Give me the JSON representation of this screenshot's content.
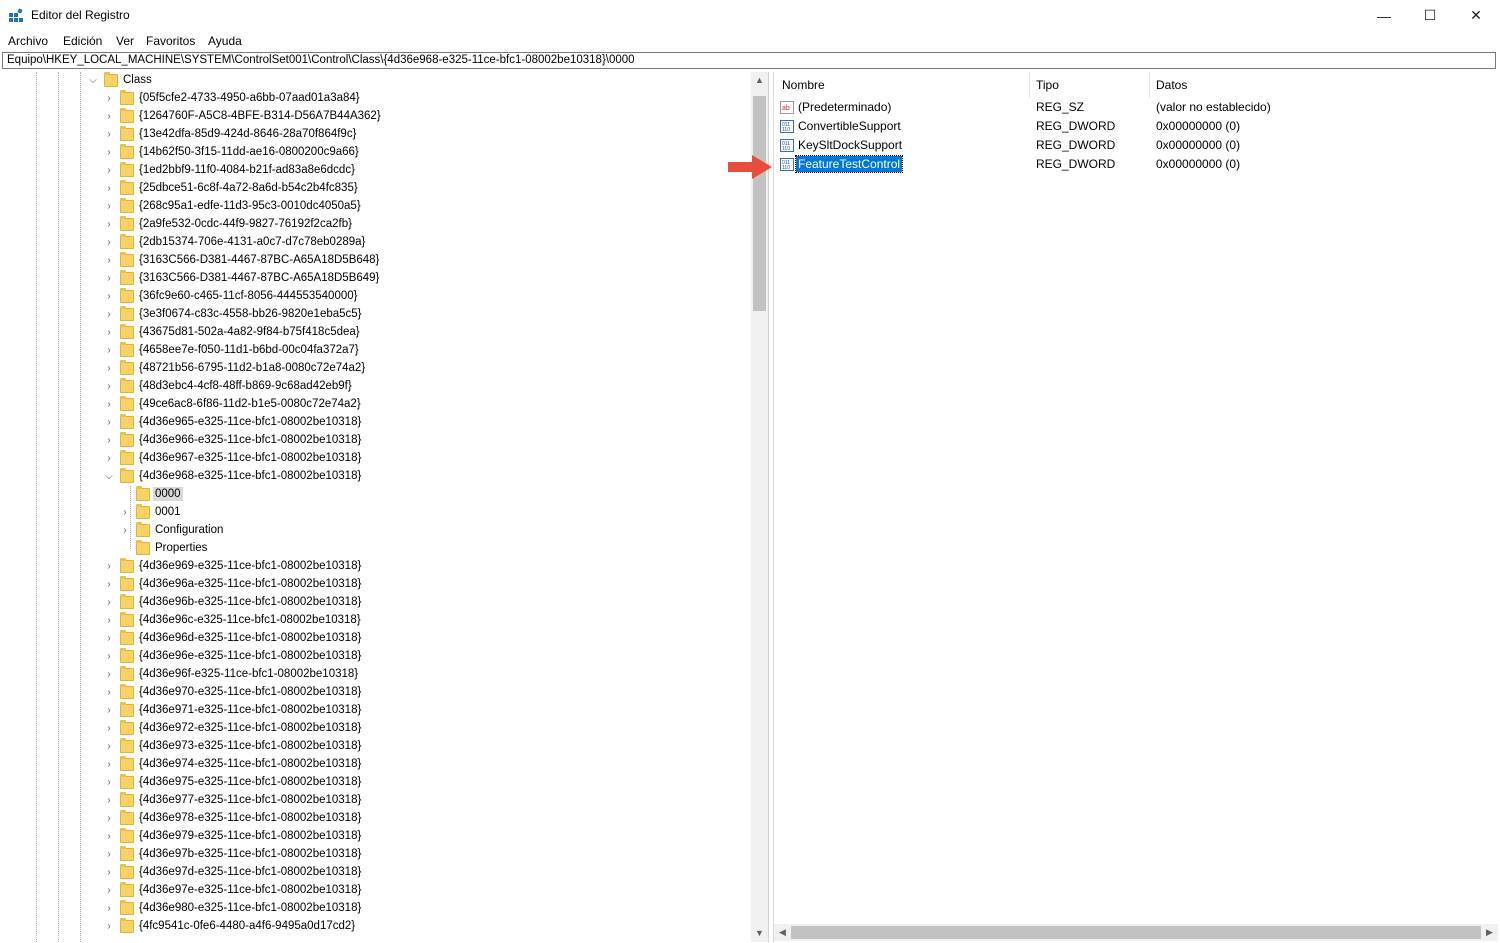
{
  "window": {
    "title": "Editor del Registro",
    "min": "—",
    "max": "☐",
    "close": "✕"
  },
  "menu": [
    "Archivo",
    "Edición",
    "Ver",
    "Favoritos",
    "Ayuda"
  ],
  "address": "Equipo\\HKEY_LOCAL_MACHINE\\SYSTEM\\ControlSet001\\Control\\Class\\{4d36e968-e325-11ce-bfc1-08002be10318}\\0000",
  "tree": {
    "root": {
      "label": "Class",
      "expanded": true
    },
    "items": [
      "{05f5cfe2-4733-4950-a6bb-07aad01a3a84}",
      "{1264760F-A5C8-4BFE-B314-D56A7B44A362}",
      "{13e42dfa-85d9-424d-8646-28a70f864f9c}",
      "{14b62f50-3f15-11dd-ae16-0800200c9a66}",
      "{1ed2bbf9-11f0-4084-b21f-ad83a8e6dcdc}",
      "{25dbce51-6c8f-4a72-8a6d-b54c2b4fc835}",
      "{268c95a1-edfe-11d3-95c3-0010dc4050a5}",
      "{2a9fe532-0cdc-44f9-9827-76192f2ca2fb}",
      "{2db15374-706e-4131-a0c7-d7c78eb0289a}",
      "{3163C566-D381-4467-87BC-A65A18D5B648}",
      "{3163C566-D381-4467-87BC-A65A18D5B649}",
      "{36fc9e60-c465-11cf-8056-444553540000}",
      "{3e3f0674-c83c-4558-bb26-9820e1eba5c5}",
      "{43675d81-502a-4a82-9f84-b75f418c5dea}",
      "{4658ee7e-f050-11d1-b6bd-00c04fa372a7}",
      "{48721b56-6795-11d2-b1a8-0080c72e74a2}",
      "{48d3ebc4-4cf8-48ff-b869-9c68ad42eb9f}",
      "{49ce6ac8-6f86-11d2-b1e5-0080c72e74a2}",
      "{4d36e965-e325-11ce-bfc1-08002be10318}",
      "{4d36e966-e325-11ce-bfc1-08002be10318}",
      "{4d36e967-e325-11ce-bfc1-08002be10318}",
      "{4d36e968-e325-11ce-bfc1-08002be10318}"
    ],
    "expanded_item": "{4d36e968-e325-11ce-bfc1-08002be10318}",
    "children": [
      {
        "label": "0000",
        "selected": true,
        "has_children": false
      },
      {
        "label": "0001",
        "selected": false,
        "has_children": true
      },
      {
        "label": "Configuration",
        "selected": false,
        "has_children": true
      },
      {
        "label": "Properties",
        "selected": false,
        "has_children": false
      }
    ],
    "items_after": [
      "{4d36e969-e325-11ce-bfc1-08002be10318}",
      "{4d36e96a-e325-11ce-bfc1-08002be10318}",
      "{4d36e96b-e325-11ce-bfc1-08002be10318}",
      "{4d36e96c-e325-11ce-bfc1-08002be10318}",
      "{4d36e96d-e325-11ce-bfc1-08002be10318}",
      "{4d36e96e-e325-11ce-bfc1-08002be10318}",
      "{4d36e96f-e325-11ce-bfc1-08002be10318}",
      "{4d36e970-e325-11ce-bfc1-08002be10318}",
      "{4d36e971-e325-11ce-bfc1-08002be10318}",
      "{4d36e972-e325-11ce-bfc1-08002be10318}",
      "{4d36e973-e325-11ce-bfc1-08002be10318}",
      "{4d36e974-e325-11ce-bfc1-08002be10318}",
      "{4d36e975-e325-11ce-bfc1-08002be10318}",
      "{4d36e977-e325-11ce-bfc1-08002be10318}",
      "{4d36e978-e325-11ce-bfc1-08002be10318}",
      "{4d36e979-e325-11ce-bfc1-08002be10318}",
      "{4d36e97b-e325-11ce-bfc1-08002be10318}",
      "{4d36e97d-e325-11ce-bfc1-08002be10318}",
      "{4d36e97e-e325-11ce-bfc1-08002be10318}",
      "{4d36e980-e325-11ce-bfc1-08002be10318}",
      "{4fc9541c-0fe6-4480-a4f6-9495a0d17cd2}"
    ]
  },
  "values": {
    "headers": {
      "name": "Nombre",
      "type": "Tipo",
      "data": "Datos"
    },
    "rows": [
      {
        "name": "(Predeterminado)",
        "type": "REG_SZ",
        "data": "(valor no establecido)",
        "icon": "string-value-icon",
        "selected": false
      },
      {
        "name": "ConvertibleSupport",
        "type": "REG_DWORD",
        "data": "0x00000000 (0)",
        "icon": "binary-value-icon",
        "selected": false
      },
      {
        "name": "KeySltDockSupport",
        "type": "REG_DWORD",
        "data": "0x00000000 (0)",
        "icon": "binary-value-icon",
        "selected": false
      },
      {
        "name": "FeatureTestControl",
        "type": "REG_DWORD",
        "data": "0x00000000 (0)",
        "icon": "binary-value-icon",
        "selected": true
      }
    ]
  },
  "colors": {
    "selection": "#0078d7",
    "folder": "#f6d366",
    "annotation_arrow": "#e84c3d"
  }
}
